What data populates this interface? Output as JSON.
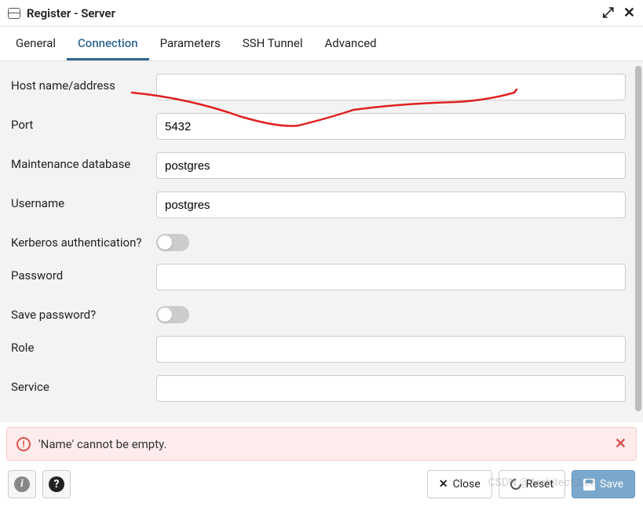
{
  "header": {
    "title": "Register - Server"
  },
  "tabs": [
    {
      "label": "General",
      "active": false
    },
    {
      "label": "Connection",
      "active": true
    },
    {
      "label": "Parameters",
      "active": false
    },
    {
      "label": "SSH Tunnel",
      "active": false
    },
    {
      "label": "Advanced",
      "active": false
    }
  ],
  "form": {
    "host": {
      "label": "Host name/address",
      "value": ""
    },
    "port": {
      "label": "Port",
      "value": "5432"
    },
    "maintenance_db": {
      "label": "Maintenance database",
      "value": "postgres"
    },
    "username": {
      "label": "Username",
      "value": "postgres"
    },
    "kerberos": {
      "label": "Kerberos authentication?",
      "on": false
    },
    "password": {
      "label": "Password",
      "value": ""
    },
    "save_password": {
      "label": "Save password?",
      "on": false
    },
    "role": {
      "label": "Role",
      "value": ""
    },
    "service": {
      "label": "Service",
      "value": ""
    }
  },
  "alert": {
    "message": "'Name' cannot be empty."
  },
  "footer": {
    "close": "Close",
    "reset": "Reset",
    "save": "Save"
  },
  "watermark": "CSDN @Architect_Lee"
}
